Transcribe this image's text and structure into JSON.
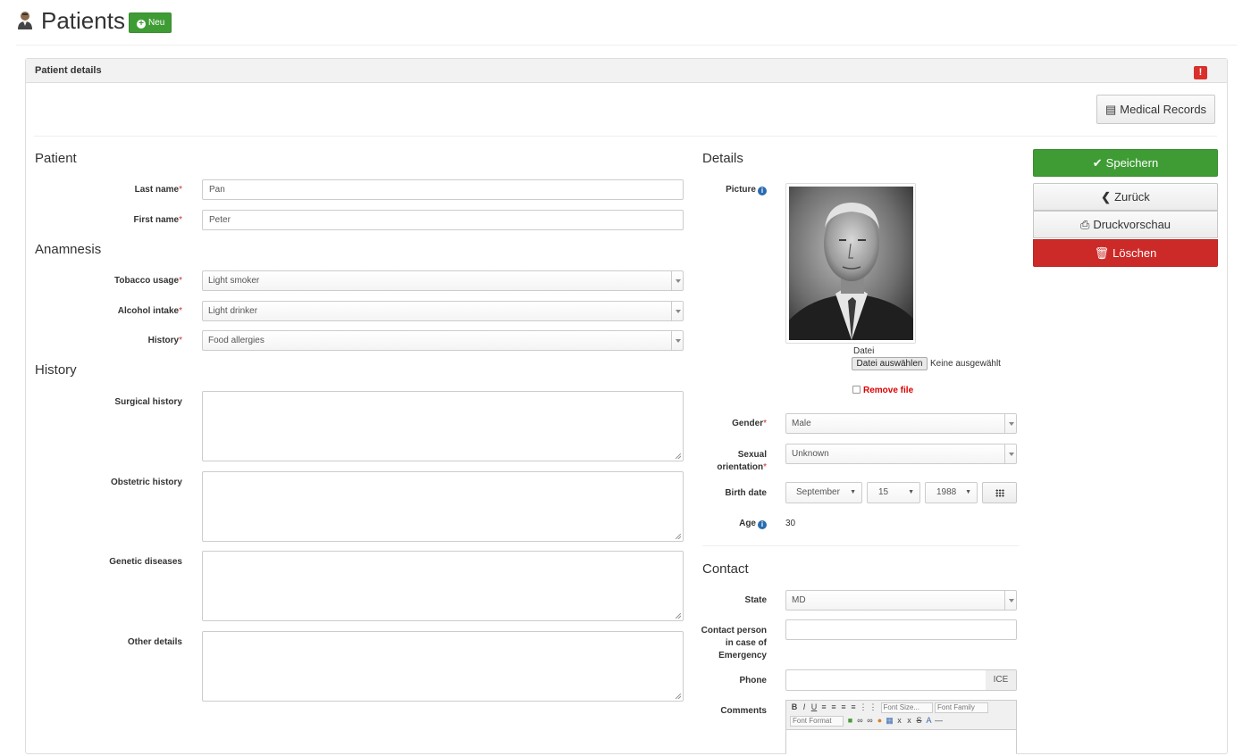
{
  "header": {
    "title": "Patients",
    "new_label": "Neu"
  },
  "panel": {
    "title": "Patient details",
    "badge": "!",
    "medical_records_label": "Medical Records"
  },
  "sections": {
    "patient": "Patient",
    "anamnesis": "Anamnesis",
    "history": "History",
    "details": "Details",
    "contact": "Contact"
  },
  "patient": {
    "last_name_label": "Last name",
    "last_name_value": "Pan",
    "first_name_label": "First name",
    "first_name_value": "Peter"
  },
  "anamnesis": {
    "tobacco_label": "Tobacco usage",
    "tobacco_value": "Light smoker",
    "alcohol_label": "Alcohol intake",
    "alcohol_value": "Light drinker",
    "history_label": "History",
    "history_value": "Food allergies"
  },
  "history": {
    "surgical_label": "Surgical history",
    "obstetric_label": "Obstetric history",
    "genetic_label": "Genetic diseases",
    "other_label": "Other details"
  },
  "details": {
    "picture_label": "Picture",
    "file_label": "Datei",
    "file_button": "Datei auswählen",
    "file_none": "Keine ausgewählt",
    "remove_file": "Remove file",
    "gender_label": "Gender",
    "gender_value": "Male",
    "sexual_label_1": "Sexual",
    "sexual_label_2": "orientation",
    "sexual_value": "Unknown",
    "birth_label": "Birth date",
    "birth_month": "September",
    "birth_day": "15",
    "birth_year": "1988",
    "age_label": "Age",
    "age_value": "30"
  },
  "contact": {
    "state_label": "State",
    "state_value": "MD",
    "emergency_label_1": "Contact person",
    "emergency_label_2": "in case of",
    "emergency_label_3": "Emergency",
    "phone_label": "Phone",
    "phone_addon": "ICE",
    "comments_label": "Comments",
    "font_size_placeholder": "Font Size...",
    "font_family_placeholder": "Font Family",
    "font_format_placeholder": "Font Format"
  },
  "actions": {
    "save": "Speichern",
    "back": "Zurück",
    "print": "Druckvorschau",
    "delete": "Löschen"
  },
  "colors": {
    "primary_green": "#3f9c35",
    "danger_red": "#cc2a28",
    "info_blue": "#2a6bb0"
  }
}
